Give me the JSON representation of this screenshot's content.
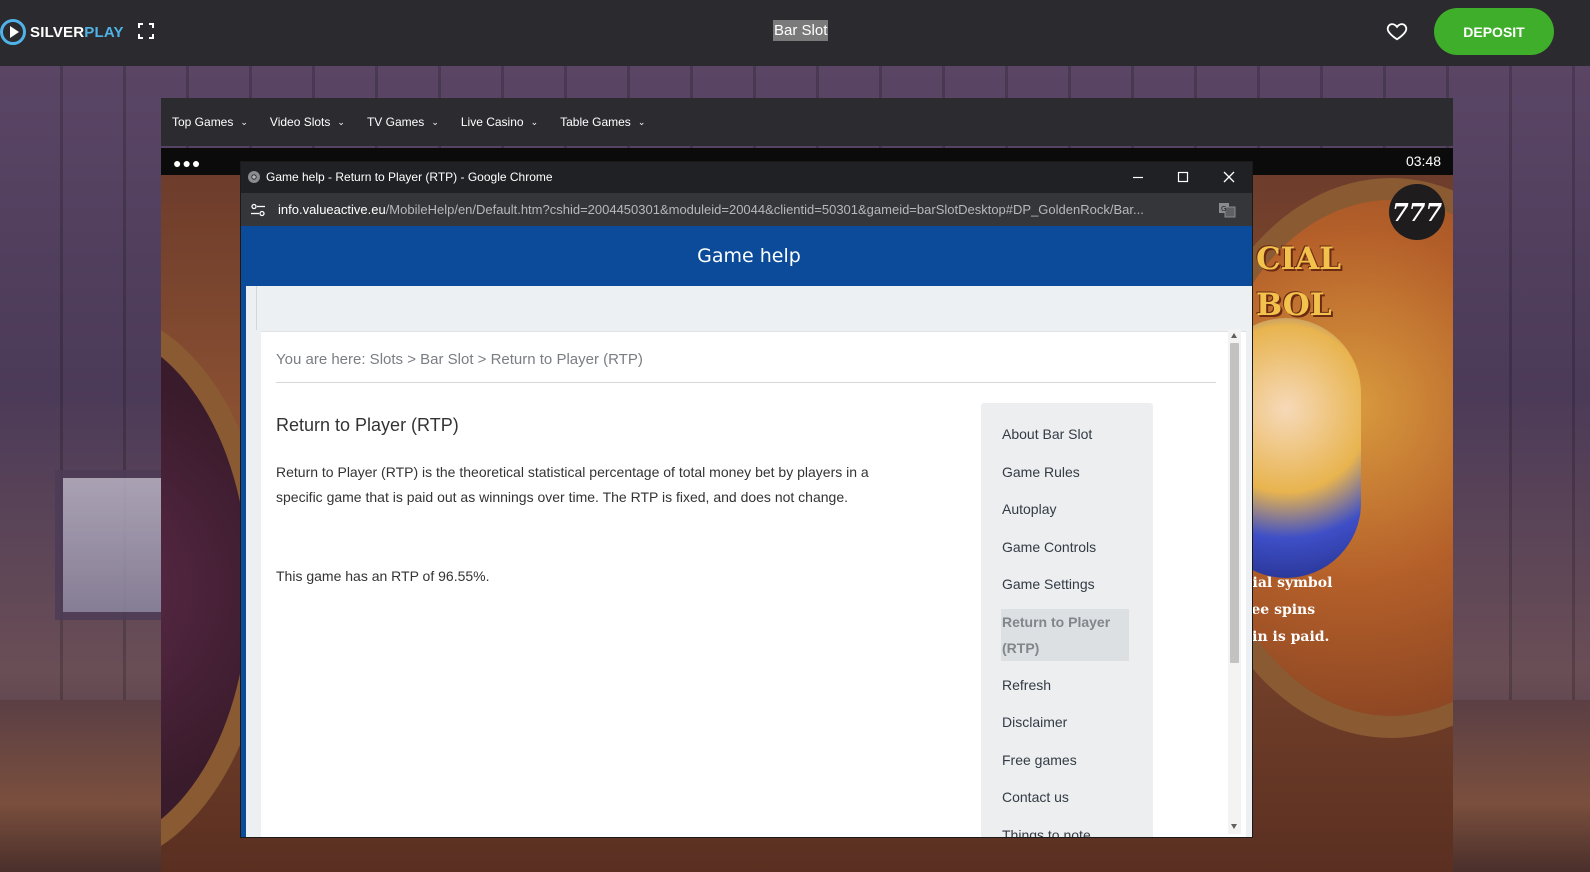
{
  "site": {
    "logo_silver": "SILVER",
    "logo_play": "PLAY",
    "page_title": "Bar Slot",
    "deposit_label": "DEPOSIT",
    "icons": {
      "logo": "play-circle-icon",
      "fullscreen": "fullscreen-icon",
      "favorite": "heart-icon"
    },
    "colors": {
      "topbar": "#2b2a2e",
      "deposit": "#3fae2b",
      "logo_accent": "#4fb3e8"
    }
  },
  "nav": {
    "items": [
      {
        "label": "Top Games"
      },
      {
        "label": "Video Slots"
      },
      {
        "label": "TV Games"
      },
      {
        "label": "Live Casino"
      },
      {
        "label": "Table Games"
      }
    ]
  },
  "game": {
    "menu_dots": "●●●",
    "clock": "03:48",
    "badge": "777",
    "title_line1": "CIAL",
    "title_line2": "BOL",
    "text_line1": "cial symbol",
    "text_line2": "ree spins",
    "text_line3": "vin is paid."
  },
  "popup": {
    "window_title": "Game help - Return to Player (RTP) - Google Chrome",
    "url_domain": "info.valueactive.eu",
    "url_path": "/MobileHelp/en/Default.htm?cshid=2004450301&moduleid=20044&clientid=50301&gameid=barSlotDesktop#DP_GoldenRock/Bar...",
    "header_title": "Game help",
    "breadcrumb": "You are here: Slots > Bar Slot > Return to Player (RTP)",
    "heading": "Return to Player (RTP)",
    "paragraph": "Return to Player (RTP) is the theoretical statistical percentage of total money bet by players in a specific game that is paid out as winnings over time. The RTP is fixed, and does not change.",
    "rtp_line": "This game has an RTP of 96.55%.",
    "sidenav": [
      {
        "label": "About Bar Slot",
        "active": false
      },
      {
        "label": "Game Rules",
        "active": false
      },
      {
        "label": "Autoplay",
        "active": false
      },
      {
        "label": "Game Controls",
        "active": false
      },
      {
        "label": "Game Settings",
        "active": false
      },
      {
        "label": "Return to Player (RTP)",
        "active": true
      },
      {
        "label": "Refresh",
        "active": false
      },
      {
        "label": "Disclaimer",
        "active": false
      },
      {
        "label": "Free games",
        "active": false
      },
      {
        "label": "Contact us",
        "active": false
      },
      {
        "label": "Things to note",
        "active": false
      }
    ],
    "colors": {
      "header": "#0b4b99",
      "titlebar": "#202124",
      "urlbar": "#35363a"
    }
  }
}
